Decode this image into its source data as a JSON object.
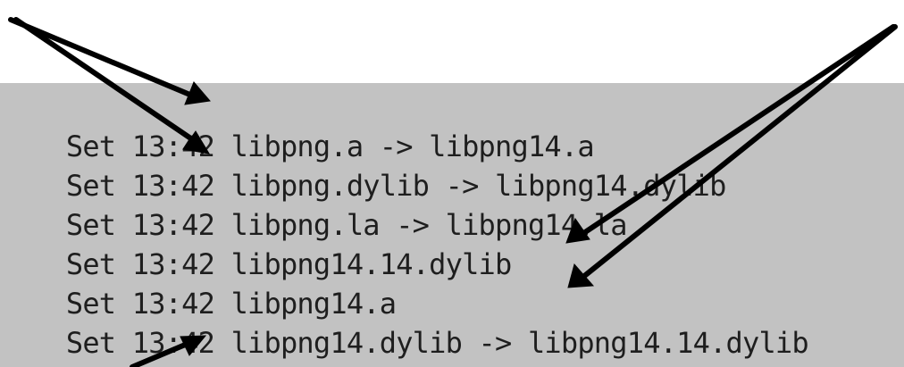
{
  "terminal": {
    "lines": [
      {
        "date": "Set",
        "time": "13:42",
        "name": "libpng.a -> libpng14.a"
      },
      {
        "date": "Set",
        "time": "13:42",
        "name": "libpng.dylib -> libpng14.dylib"
      },
      {
        "date": "Set",
        "time": "13:42",
        "name": "libpng.la -> libpng14.la"
      },
      {
        "date": "Set",
        "time": "13:42",
        "name": "libpng14.14.dylib"
      },
      {
        "date": "Set",
        "time": "13:42",
        "name": "libpng14.a"
      },
      {
        "date": "Set",
        "time": "13:42",
        "name": "libpng14.dylib -> libpng14.14.dylib"
      }
    ]
  },
  "annotations": {
    "color": "#000000",
    "arrows": [
      "arrow-to-libpng-a",
      "arrow-to-libpng-dylib",
      "arrow-to-libpng14-14-dylib",
      "arrow-to-libpng14-a",
      "arrow-to-libpng14-dylib"
    ]
  }
}
